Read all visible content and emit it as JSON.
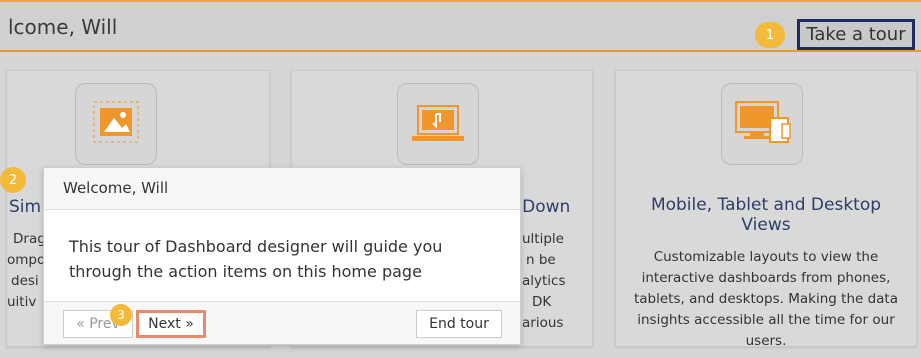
{
  "header": {
    "title": "lcome, Will",
    "tour_button": "Take a tour"
  },
  "steps": [
    "1",
    "2",
    "3"
  ],
  "cards": [
    {
      "title_fragment": "Sim",
      "desc_fragments": [
        "Drag",
        "ompo",
        "desi",
        "uitiv"
      ]
    },
    {
      "title_fragment": "l Down",
      "desc_fragments": [
        "ultiple",
        "n be",
        "alytics",
        "DK",
        "arious"
      ]
    },
    {
      "title": "Mobile, Tablet and Desktop Views",
      "description": "Customizable layouts to view the interactive dashboards from phones, tablets, and desktops. Making the data insights accessible all the time for our users."
    }
  ],
  "popover": {
    "title": "Welcome, Will",
    "body": "This tour of Dashboard designer will guide you through the action items on this home page",
    "prev": "« Prev",
    "next": "Next »",
    "end": "End tour"
  },
  "colors": {
    "accent": "#f3b93a",
    "tour_border": "#1f2a5e",
    "next_highlight": "#e88a6c",
    "title_blue": "#2c3e66",
    "icon_orange": "#f0962a"
  },
  "icons": [
    "image-dashed-icon",
    "laptop-touch-icon",
    "devices-icon"
  ]
}
